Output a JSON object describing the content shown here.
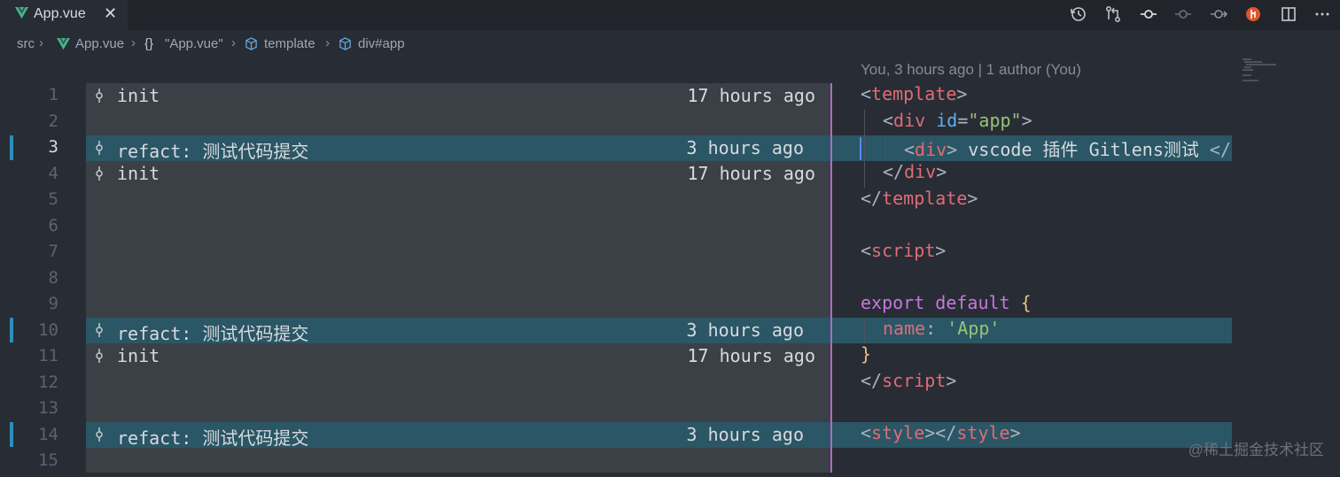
{
  "tab": {
    "file_name": "App.vue",
    "close": "✕"
  },
  "toolbar_icons": [
    "file-history-icon",
    "compare-changes-icon",
    "commit-icon",
    "previous-commit-icon",
    "next-commit-icon",
    "gitlens-icon",
    "split-editor-icon",
    "more-actions-icon"
  ],
  "breadcrumb": {
    "items": [
      "src",
      "App.vue",
      "\"App.vue\"",
      "template",
      "div#app"
    ],
    "braces": "{}"
  },
  "codelens": "You, 3 hours ago | 1 author (You)",
  "line_numbers": [
    "1",
    "2",
    "3",
    "4",
    "5",
    "6",
    "7",
    "8",
    "9",
    "10",
    "11",
    "12",
    "13",
    "14",
    "15"
  ],
  "active_line": "3",
  "blame": [
    {
      "msg": "init",
      "time": "17 hours ago"
    },
    {
      "msg": "refact: 测试代码提交",
      "time": "3 hours ago"
    },
    {
      "msg": "init",
      "time": "17 hours ago"
    },
    {
      "msg": "refact: 测试代码提交",
      "time": "3 hours ago"
    },
    {
      "msg": "init",
      "time": "17 hours ago"
    },
    {
      "msg": "refact: 测试代码提交",
      "time": "3 hours ago"
    }
  ],
  "code": {
    "l1_open": "<",
    "l1_tag": "template",
    "l1_close": ">",
    "l2_open": "<",
    "l2_tag": "div",
    "l2_attr": "id",
    "l2_eq": "=",
    "l2_val": "\"app\"",
    "l2_close": ">",
    "l3_open": "<",
    "l3_tag": "div",
    "l3_close": ">",
    "l3_text": " vscode 插件 Gitlens测试 ",
    "l3_end": "</",
    "l4_open": "</",
    "l4_tag": "div",
    "l4_close": ">",
    "l5_open": "</",
    "l5_tag": "template",
    "l5_close": ">",
    "l7_open": "<",
    "l7_tag": "script",
    "l7_close": ">",
    "l9_kw1": "export",
    "l9_kw2": "default",
    "l9_brace": "{",
    "l10_prop": "name",
    "l10_colon": ":",
    "l10_val": "'App'",
    "l11_brace": "}",
    "l12_open": "</",
    "l12_tag": "script",
    "l12_close": ">",
    "l14_open": "<",
    "l14_tag": "style",
    "l14_mid": "></",
    "l14_tag2": "style",
    "l14_close": ">"
  },
  "watermark": "@稀土掘金技术社区",
  "colors": {
    "editor_bg": "#282c34",
    "blame_bg": "#3b4046",
    "highlight": "#2a5665",
    "accent": "#2b8fb8",
    "tag": "#e06c75",
    "string": "#98c379",
    "keyword": "#c678dd"
  }
}
